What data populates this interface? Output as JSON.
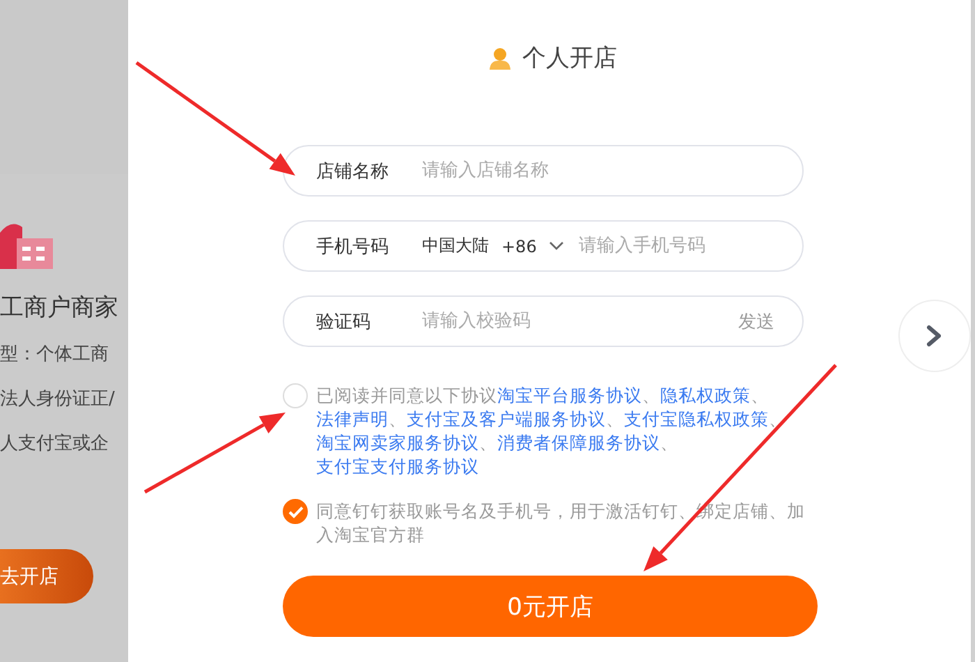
{
  "background_card": {
    "title": "工商户商家",
    "lines": [
      "型：个体工商",
      "法人身份证正/",
      "人支付宝或企"
    ],
    "button": "去开店"
  },
  "dialog": {
    "title": "个人开店",
    "fields": [
      {
        "kind": "text",
        "label": "店铺名称",
        "placeholder": "请输入店铺名称"
      },
      {
        "kind": "phone",
        "label": "手机号码",
        "region": "中国大陆",
        "code": "+86",
        "placeholder": "请输入手机号码"
      },
      {
        "kind": "code",
        "label": "验证码",
        "placeholder": "请输入校验码",
        "action": "发送",
        "action_disabled": true
      }
    ],
    "agreements": [
      {
        "checked": false,
        "parts": [
          {
            "kind": "text",
            "text": "已阅读并同意以下协议"
          },
          {
            "kind": "link",
            "text": "淘宝平台服务协议"
          },
          {
            "kind": "text",
            "text": "、"
          },
          {
            "kind": "link",
            "text": "隐私权政策"
          },
          {
            "kind": "text",
            "text": "、"
          },
          {
            "kind": "link",
            "text": "法律声明"
          },
          {
            "kind": "text",
            "text": "、"
          },
          {
            "kind": "link",
            "text": "支付宝及客户端服务协议"
          },
          {
            "kind": "text",
            "text": "、"
          },
          {
            "kind": "link",
            "text": "支付宝隐私权政策"
          },
          {
            "kind": "text",
            "text": "、"
          },
          {
            "kind": "link",
            "text": "淘宝网卖家服务协议"
          },
          {
            "kind": "text",
            "text": "、"
          },
          {
            "kind": "link",
            "text": "消费者保障服务协议"
          },
          {
            "kind": "text",
            "text": "、"
          },
          {
            "kind": "link",
            "text": "支付宝支付服务协议"
          }
        ]
      },
      {
        "checked": true,
        "parts": [
          {
            "kind": "text",
            "text": "同意钉钉获取账号名及手机号，用于激活钉钉、绑定店铺、加入淘宝官方群"
          }
        ]
      }
    ],
    "submit": "0元开店"
  }
}
